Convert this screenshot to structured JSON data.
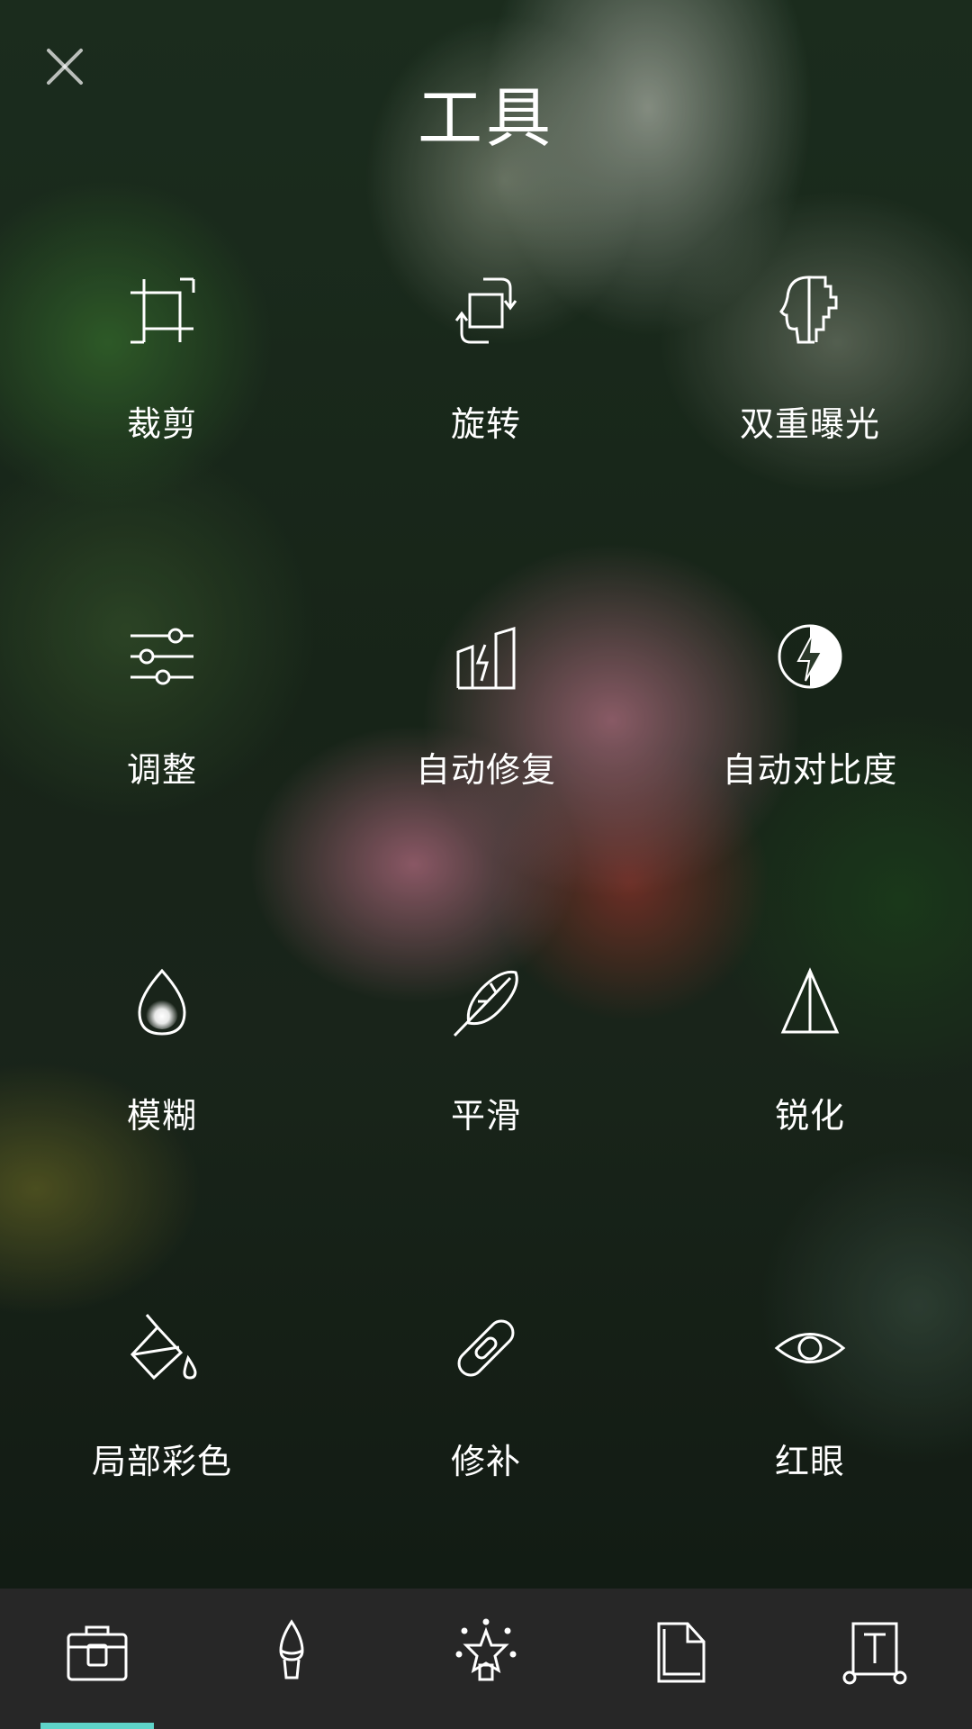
{
  "header": {
    "title": "工具",
    "close_icon": "close-icon"
  },
  "tools": [
    {
      "label": "裁剪",
      "icon": "crop-icon"
    },
    {
      "label": "旋转",
      "icon": "rotate-icon"
    },
    {
      "label": "双重曝光",
      "icon": "double-exposure-icon"
    },
    {
      "label": "调整",
      "icon": "sliders-icon"
    },
    {
      "label": "自动修复",
      "icon": "auto-fix-icon"
    },
    {
      "label": "自动对比度",
      "icon": "auto-contrast-icon"
    },
    {
      "label": "模糊",
      "icon": "blur-drop-icon"
    },
    {
      "label": "平滑",
      "icon": "smooth-feather-icon"
    },
    {
      "label": "锐化",
      "icon": "sharpen-triangle-icon"
    },
    {
      "label": "局部彩色",
      "icon": "paint-bucket-icon"
    },
    {
      "label": "修补",
      "icon": "bandage-icon"
    },
    {
      "label": "红眼",
      "icon": "eye-icon"
    }
  ],
  "bottom_nav": {
    "items": [
      {
        "icon": "toolbox-icon",
        "selected": true
      },
      {
        "icon": "brush-icon",
        "selected": false
      },
      {
        "icon": "effects-star-icon",
        "selected": false
      },
      {
        "icon": "sticker-icon",
        "selected": false
      },
      {
        "icon": "text-icon",
        "selected": false
      }
    ],
    "indicator_color": "#5ed3c8"
  }
}
